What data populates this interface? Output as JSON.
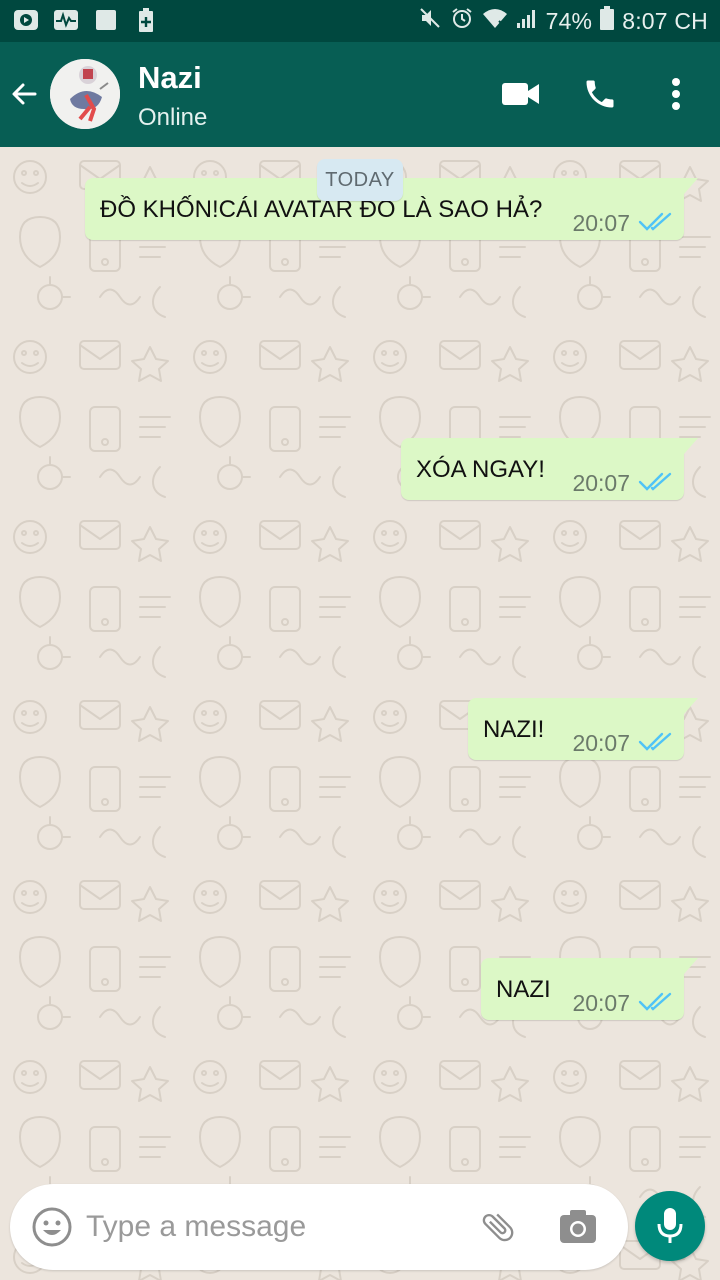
{
  "status_bar": {
    "battery": "74%",
    "time": "8:07 CH",
    "left_icons": [
      "youtube-icon",
      "activity-icon",
      "gallery-icon",
      "battery-plus-icon"
    ],
    "right_icons": [
      "mute-icon",
      "alarm-icon",
      "wifi-icon",
      "signal-icon",
      "battery-icon"
    ]
  },
  "header": {
    "contact_name": "Nazi",
    "contact_status": "Online",
    "icons": [
      "back-arrow-icon",
      "video-call-icon",
      "phone-icon",
      "more-vert-icon"
    ]
  },
  "chat": {
    "date_label": "TODAY",
    "messages": [
      {
        "text": "ĐỒ KHỐN!CÁI AVATAR ĐÓ LÀ SAO HẢ?",
        "time": "20:07",
        "status": "read"
      },
      {
        "text": "XÓA NGAY!",
        "time": "20:07",
        "status": "read"
      },
      {
        "text": "NAZI!",
        "time": "20:07",
        "status": "read"
      },
      {
        "text": "NAZI",
        "time": "20:07",
        "status": "read"
      }
    ]
  },
  "input": {
    "placeholder": "Type a message",
    "icons": [
      "emoji-icon",
      "attach-icon",
      "camera-icon",
      "mic-icon"
    ]
  },
  "colors": {
    "status_bar": "#00483f",
    "header": "#075e54",
    "outgoing_bubble": "#dcf8c6",
    "chat_background": "#ece5dd",
    "read_ticks": "#4fc3f7",
    "mic_button": "#00897b"
  }
}
